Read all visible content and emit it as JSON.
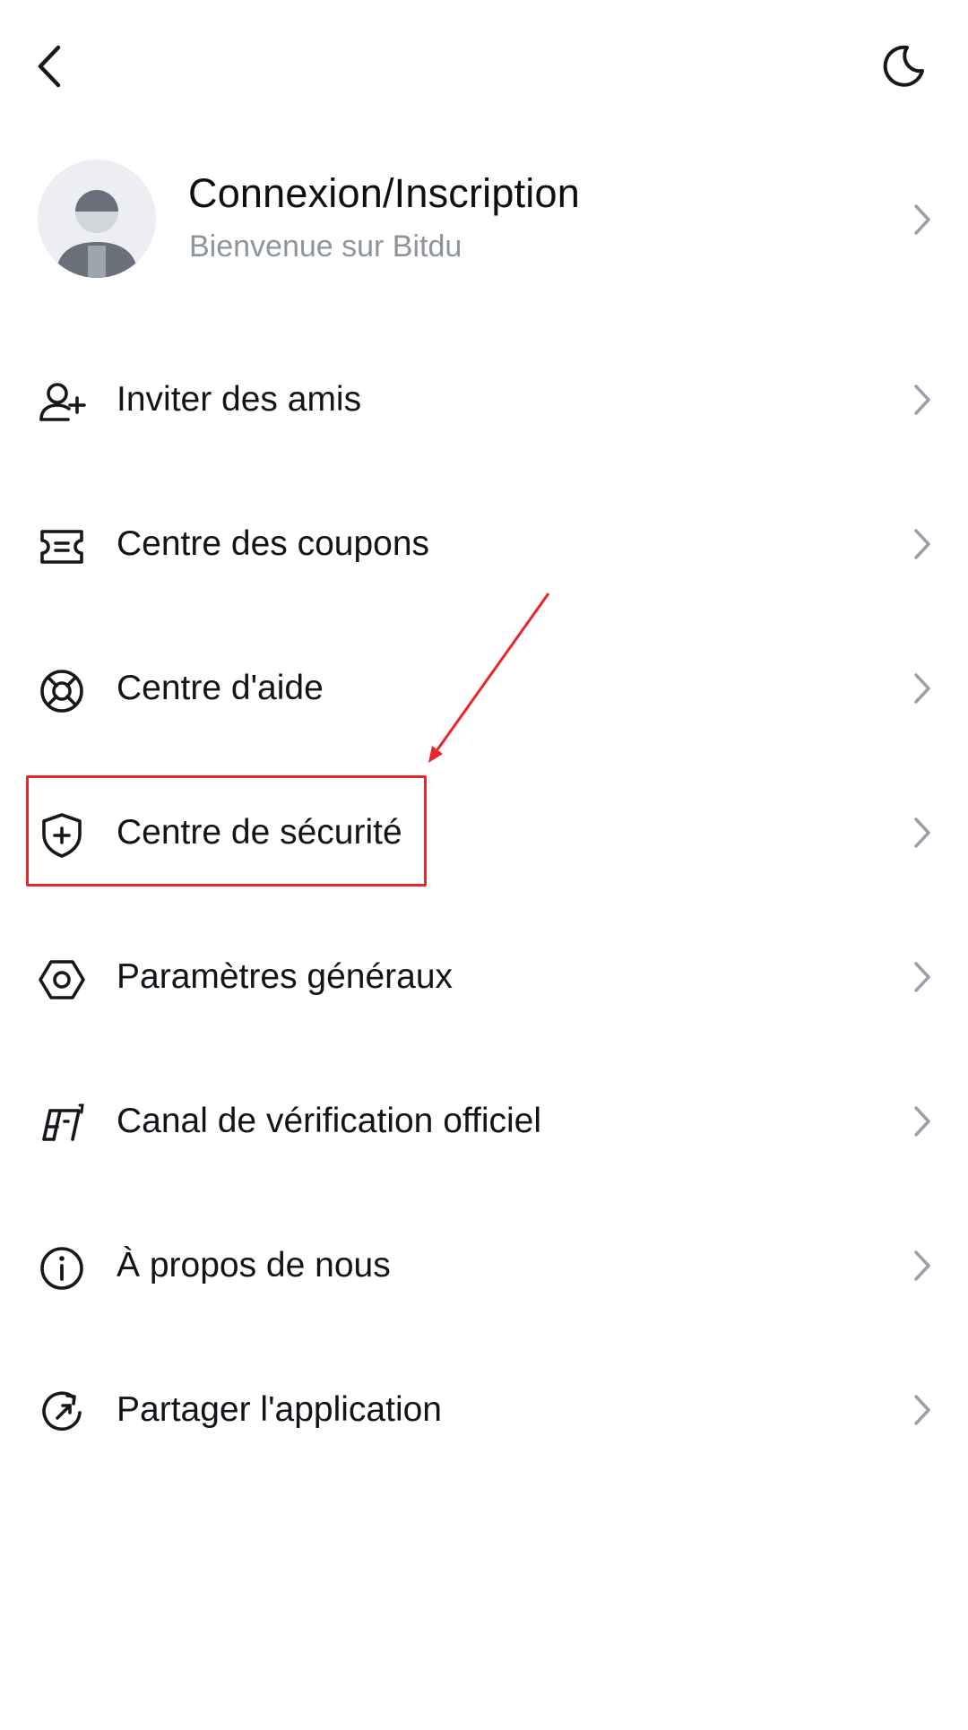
{
  "header": {
    "back_icon": "chevron-left-icon",
    "theme_icon": "moon-icon"
  },
  "profile": {
    "title": "Connexion/Inscription",
    "subtitle": "Bienvenue sur Bitdu"
  },
  "menu": [
    {
      "label": "Inviter des amis",
      "icon": "add-user-icon"
    },
    {
      "label": "Centre des coupons",
      "icon": "ticket-icon"
    },
    {
      "label": "Centre d'aide",
      "icon": "lifebuoy-icon"
    },
    {
      "label": "Centre de sécurité",
      "icon": "shield-plus-icon"
    },
    {
      "label": "Paramètres généraux",
      "icon": "hexagon-settings-icon"
    },
    {
      "label": "Canal de vérification officiel",
      "icon": "verification-logo-icon"
    },
    {
      "label": "À propos de nous",
      "icon": "info-icon"
    },
    {
      "label": "Partager l'application",
      "icon": "share-refresh-icon"
    }
  ],
  "colors": {
    "annotation": "#e8262a",
    "chevron": "#9aa0a8",
    "subtitle": "#8e949c"
  }
}
